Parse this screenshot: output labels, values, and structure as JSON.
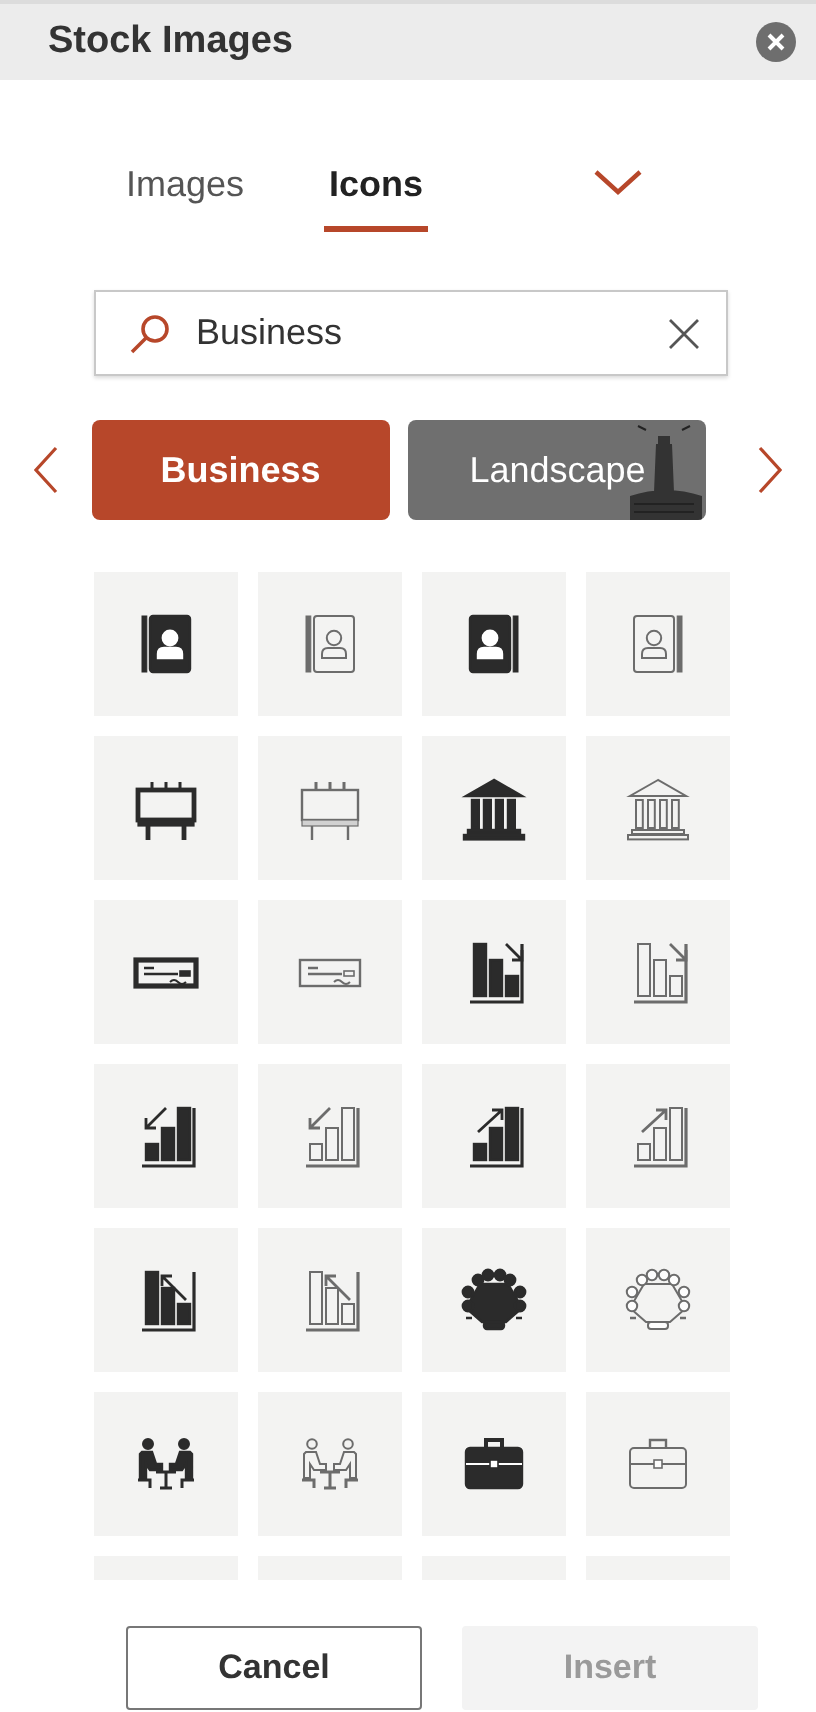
{
  "panel": {
    "title": "Stock Images"
  },
  "tabs": [
    {
      "label": "Images",
      "selected": false
    },
    {
      "label": "Icons",
      "selected": true
    }
  ],
  "search": {
    "value": "Business"
  },
  "categories": [
    {
      "label": "Business",
      "selected": true
    },
    {
      "label": "Landscape",
      "selected": false
    }
  ],
  "icons": [
    {
      "kind": "contact-book",
      "filled": true
    },
    {
      "kind": "contact-book",
      "filled": false
    },
    {
      "kind": "contact-book-mirrored",
      "filled": true
    },
    {
      "kind": "contact-book-mirrored",
      "filled": false
    },
    {
      "kind": "billboard",
      "filled": true
    },
    {
      "kind": "billboard",
      "filled": false
    },
    {
      "kind": "bank",
      "filled": true
    },
    {
      "kind": "bank",
      "filled": false
    },
    {
      "kind": "cheque",
      "filled": true
    },
    {
      "kind": "cheque",
      "filled": false
    },
    {
      "kind": "chart-falling",
      "filled": true
    },
    {
      "kind": "chart-falling",
      "filled": false
    },
    {
      "kind": "chart-rising-arrow-down",
      "filled": true
    },
    {
      "kind": "chart-rising-arrow-down",
      "filled": false
    },
    {
      "kind": "chart-rising",
      "filled": true
    },
    {
      "kind": "chart-rising",
      "filled": false
    },
    {
      "kind": "chart-falling-arrow-up",
      "filled": true
    },
    {
      "kind": "chart-falling-arrow-up",
      "filled": false
    },
    {
      "kind": "conference-table",
      "filled": true
    },
    {
      "kind": "conference-table",
      "filled": false
    },
    {
      "kind": "meeting",
      "filled": true
    },
    {
      "kind": "meeting",
      "filled": false
    },
    {
      "kind": "briefcase",
      "filled": true
    },
    {
      "kind": "briefcase",
      "filled": false
    },
    {
      "kind": "cut-off"
    },
    {
      "kind": "cut-off"
    },
    {
      "kind": "cut-off"
    },
    {
      "kind": "cut-off"
    }
  ],
  "buttons": [
    {
      "label": "Cancel",
      "disabled": false
    },
    {
      "label": "Insert",
      "disabled": true
    }
  ]
}
